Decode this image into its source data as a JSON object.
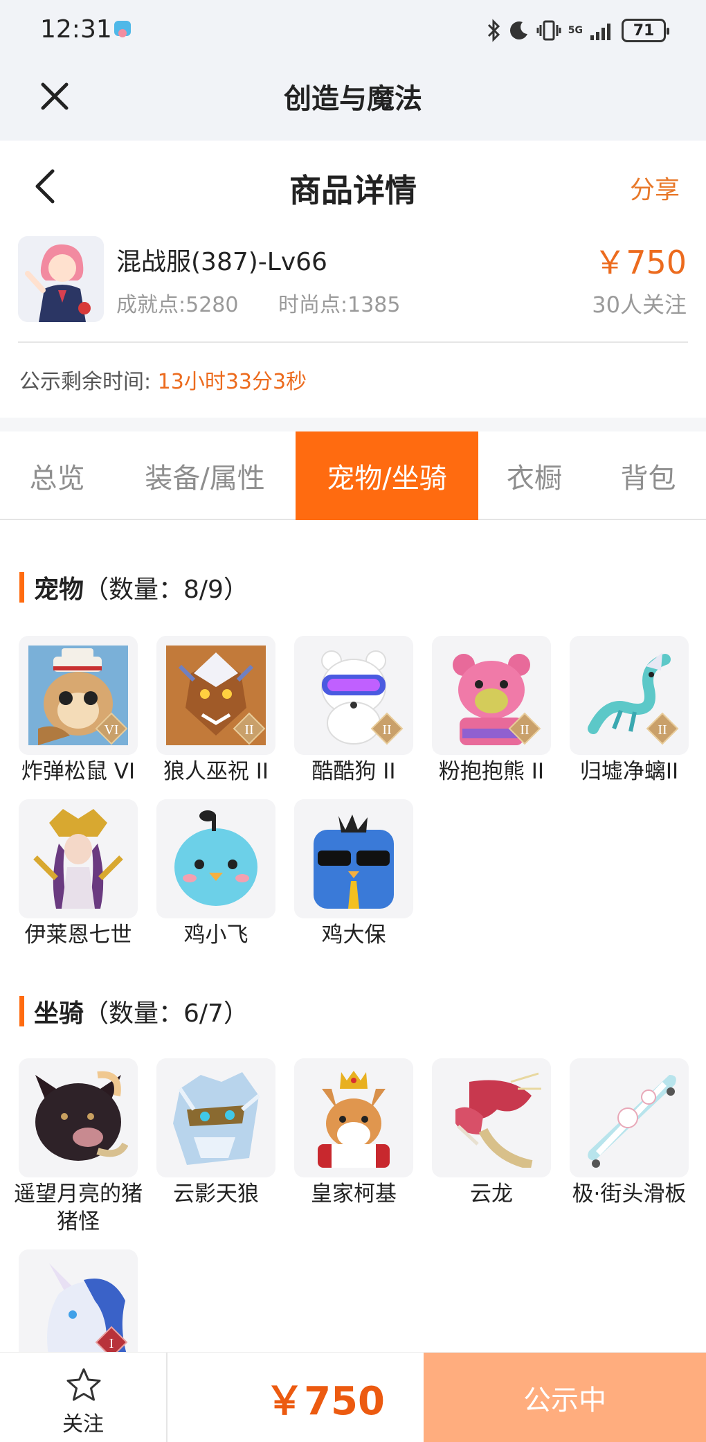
{
  "status_bar": {
    "time": "12:31",
    "battery": "71",
    "network": "5G"
  },
  "app_header": {
    "title": "创造与魔法"
  },
  "nav": {
    "title": "商品详情",
    "share_label": "分享"
  },
  "product": {
    "server_level": "混战服(387)-Lv66",
    "achievement": "成就点:5280",
    "fashion": "时尚点:1385",
    "price": "￥750",
    "followers": "30人关注"
  },
  "countdown": {
    "label": "公示剩余时间:",
    "value": "13小时33分3秒"
  },
  "tabs": [
    {
      "label": "总览",
      "active": false
    },
    {
      "label": "装备/属性",
      "active": false
    },
    {
      "label": "宠物/坐骑",
      "active": true
    },
    {
      "label": "衣橱",
      "active": false
    },
    {
      "label": "背包",
      "active": false
    }
  ],
  "pets": {
    "title": "宠物",
    "count": "（数量：8/9）",
    "items": [
      {
        "name": "炸弹松鼠 VI",
        "badge": "VI"
      },
      {
        "name": "狼人巫祝 II",
        "badge": "II"
      },
      {
        "name": "酷酷狗 II",
        "badge": "II"
      },
      {
        "name": "粉抱抱熊 II",
        "badge": "II"
      },
      {
        "name": "归墟净螭II",
        "badge": "II"
      },
      {
        "name": "伊莱恩七世",
        "badge": ""
      },
      {
        "name": "鸡小飞",
        "badge": ""
      },
      {
        "name": "鸡大保",
        "badge": ""
      }
    ]
  },
  "mounts": {
    "title": "坐骑",
    "count": "（数量：6/7）",
    "items": [
      {
        "name": "遥望月亮的猪猪怪",
        "badge": ""
      },
      {
        "name": "云影天狼",
        "badge": ""
      },
      {
        "name": "皇家柯基",
        "badge": ""
      },
      {
        "name": "云龙",
        "badge": ""
      },
      {
        "name": "极·街头滑板",
        "badge": ""
      },
      {
        "name": "",
        "badge": "I"
      }
    ]
  },
  "bottom": {
    "follow_label": "关注",
    "price": "￥750",
    "status": "公示中"
  },
  "colors": {
    "accent": "#ff6b10",
    "price": "#ec6b1e",
    "status_button": "#ffad7e"
  },
  "icons": [
    "close-icon",
    "back-icon",
    "star-icon",
    "bluetooth-icon",
    "moon-icon",
    "vibrate-icon",
    "signal-icon",
    "battery-icon"
  ]
}
